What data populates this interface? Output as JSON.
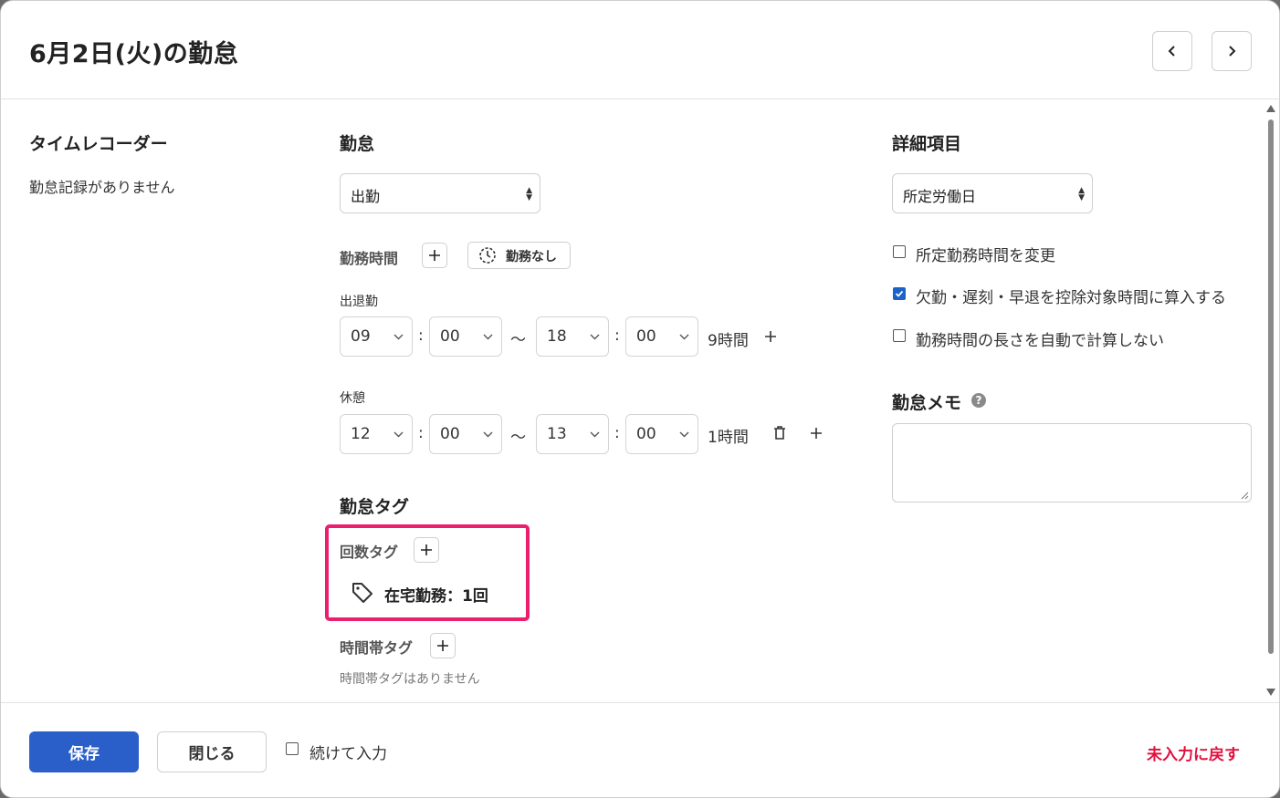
{
  "header": {
    "title": "6月2日(火)の勤怠"
  },
  "timerecorder": {
    "title": "タイムレコーダー",
    "empty_text": "勤怠記録がありません"
  },
  "attendance": {
    "title": "勤怠",
    "type_value": "出勤",
    "work_time_label": "勤務時間",
    "no_work_label": "勤務なし",
    "clock_label": "出退勤",
    "clock": {
      "start_h": "09",
      "start_m": "00",
      "end_h": "18",
      "end_m": "00",
      "duration": "9時間"
    },
    "break_label": "休憩",
    "break": {
      "start_h": "12",
      "start_m": "00",
      "end_h": "13",
      "end_m": "00",
      "duration": "1時間"
    },
    "colon": ":",
    "tilde": "〜"
  },
  "tags": {
    "title": "勤怠タグ",
    "count_tag_label": "回数タグ",
    "count_tag_item": "在宅勤務：1回",
    "time_tag_label": "時間帯タグ",
    "time_tag_empty": "時間帯タグはありません"
  },
  "details": {
    "title": "詳細項目",
    "day_type_value": "所定労働日",
    "options": [
      {
        "label": "所定勤務時間を変更",
        "checked": false
      },
      {
        "label": "欠勤・遅刻・早退を控除対象時間に算入する",
        "checked": true
      },
      {
        "label": "勤務時間の長さを自動で計算しない",
        "checked": false
      }
    ],
    "memo_title": "勤怠メモ",
    "memo_value": ""
  },
  "footer": {
    "save_label": "保存",
    "close_label": "閉じる",
    "continue_label": "続けて入力",
    "reset_label": "未入力に戻す"
  },
  "colors": {
    "primary": "#2a5fca",
    "danger": "#e0123e",
    "highlight": "#ec1e6e"
  }
}
